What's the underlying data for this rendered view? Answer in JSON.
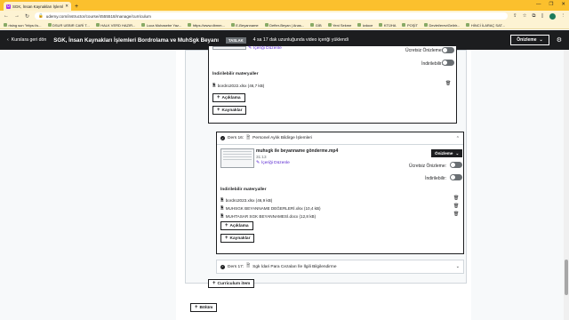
{
  "browser": {
    "tab_title": "SGK, İnsan Kaynakları İşlemleri E",
    "url": "udemy.com/instructor/course/4555518/manage/curriculum",
    "bookmarks": [
      "rising sun \"https://s...",
      "DSUR UEBIR CARİ T...",
      "HALK VERD HAZIR...",
      "Luca Muhasebe Yaz...",
      "https://www.dbmm...",
      "E-Beyanname",
      "Defter-Beyan | Anas...",
      "GİB",
      "Yeni Sekme",
      "izdoce",
      "KTÜHA",
      "POŞİT",
      "Devlet/ereviGelirlr...",
      "HİNCİ İLARAÇ SAT..."
    ]
  },
  "header": {
    "back_label": "Kurslara geri dön",
    "course_title": "SGK, İnsan Kaynakları İşlemleri Bordrolama ve MuhSgk Beyanı",
    "status_badge": "TASLAK",
    "upload_info": "4 sa 17 dak uzunluğunda video içeriği yüklendi",
    "preview_label": "Önizleme"
  },
  "top_lecture": {
    "edit_label": "İçeriği Düzenle",
    "free_preview_label": "Ücretsiz Önizleme:",
    "downloadable_label": "İndirilebilir:",
    "materials_header": "İndirilebilir materyaller",
    "files": [
      "bordro2022.xlsx (46,7 kB)"
    ],
    "description_btn": "Açıklama",
    "resources_btn": "Kaynaklar"
  },
  "lecture16": {
    "number": "Ders 16:",
    "title": "Personel Aylık Bildirge İşlemleri",
    "video_name": "muhsgk ile beyanname gönderme.mp4",
    "duration": "31:13",
    "edit_label": "İçeriği Düzenle",
    "preview_btn": "Önizleme",
    "free_preview_label": "Ücretsiz Önizleme:",
    "downloadable_label": "İndirilebilir:",
    "materials_header": "İndirilebilir materyaller",
    "files": [
      "bordro2023.xlsx (46,9 kB)",
      "MUHSGK BEYANNAME DEĞERLERİ.xlsx (10,4 kB)",
      "MUHTASAR SGK BEYANNAMESİ.docx (12,8 kB)"
    ],
    "description_btn": "Açıklama",
    "resources_btn": "Kaynaklar"
  },
  "lecture17": {
    "number": "Ders 17:",
    "title": "Sgk İdari Para Cezaları İle İlgili Bilgilendirme"
  },
  "curriculum_item_btn": "Curriculum item",
  "section_btn": "Bölüm"
}
